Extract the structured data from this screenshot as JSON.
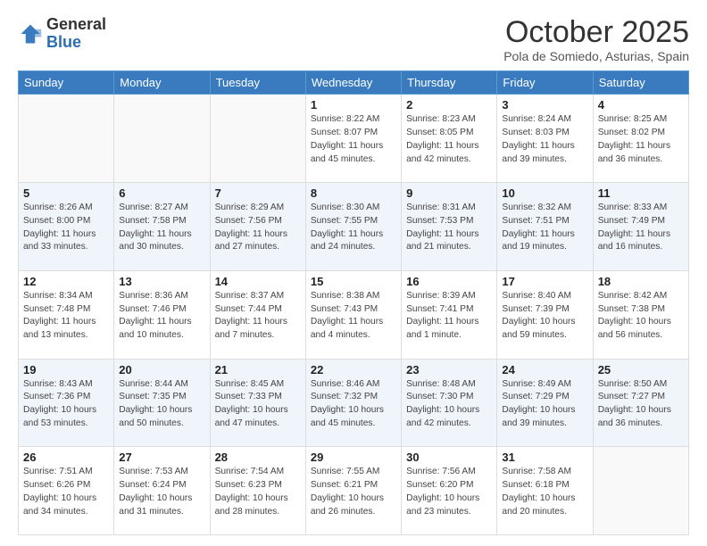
{
  "header": {
    "logo_line1": "General",
    "logo_line2": "Blue",
    "month": "October 2025",
    "location": "Pola de Somiedo, Asturias, Spain"
  },
  "weekdays": [
    "Sunday",
    "Monday",
    "Tuesday",
    "Wednesday",
    "Thursday",
    "Friday",
    "Saturday"
  ],
  "weeks": [
    [
      {
        "day": "",
        "info": ""
      },
      {
        "day": "",
        "info": ""
      },
      {
        "day": "",
        "info": ""
      },
      {
        "day": "1",
        "info": "Sunrise: 8:22 AM\nSunset: 8:07 PM\nDaylight: 11 hours\nand 45 minutes."
      },
      {
        "day": "2",
        "info": "Sunrise: 8:23 AM\nSunset: 8:05 PM\nDaylight: 11 hours\nand 42 minutes."
      },
      {
        "day": "3",
        "info": "Sunrise: 8:24 AM\nSunset: 8:03 PM\nDaylight: 11 hours\nand 39 minutes."
      },
      {
        "day": "4",
        "info": "Sunrise: 8:25 AM\nSunset: 8:02 PM\nDaylight: 11 hours\nand 36 minutes."
      }
    ],
    [
      {
        "day": "5",
        "info": "Sunrise: 8:26 AM\nSunset: 8:00 PM\nDaylight: 11 hours\nand 33 minutes."
      },
      {
        "day": "6",
        "info": "Sunrise: 8:27 AM\nSunset: 7:58 PM\nDaylight: 11 hours\nand 30 minutes."
      },
      {
        "day": "7",
        "info": "Sunrise: 8:29 AM\nSunset: 7:56 PM\nDaylight: 11 hours\nand 27 minutes."
      },
      {
        "day": "8",
        "info": "Sunrise: 8:30 AM\nSunset: 7:55 PM\nDaylight: 11 hours\nand 24 minutes."
      },
      {
        "day": "9",
        "info": "Sunrise: 8:31 AM\nSunset: 7:53 PM\nDaylight: 11 hours\nand 21 minutes."
      },
      {
        "day": "10",
        "info": "Sunrise: 8:32 AM\nSunset: 7:51 PM\nDaylight: 11 hours\nand 19 minutes."
      },
      {
        "day": "11",
        "info": "Sunrise: 8:33 AM\nSunset: 7:49 PM\nDaylight: 11 hours\nand 16 minutes."
      }
    ],
    [
      {
        "day": "12",
        "info": "Sunrise: 8:34 AM\nSunset: 7:48 PM\nDaylight: 11 hours\nand 13 minutes."
      },
      {
        "day": "13",
        "info": "Sunrise: 8:36 AM\nSunset: 7:46 PM\nDaylight: 11 hours\nand 10 minutes."
      },
      {
        "day": "14",
        "info": "Sunrise: 8:37 AM\nSunset: 7:44 PM\nDaylight: 11 hours\nand 7 minutes."
      },
      {
        "day": "15",
        "info": "Sunrise: 8:38 AM\nSunset: 7:43 PM\nDaylight: 11 hours\nand 4 minutes."
      },
      {
        "day": "16",
        "info": "Sunrise: 8:39 AM\nSunset: 7:41 PM\nDaylight: 11 hours\nand 1 minute."
      },
      {
        "day": "17",
        "info": "Sunrise: 8:40 AM\nSunset: 7:39 PM\nDaylight: 10 hours\nand 59 minutes."
      },
      {
        "day": "18",
        "info": "Sunrise: 8:42 AM\nSunset: 7:38 PM\nDaylight: 10 hours\nand 56 minutes."
      }
    ],
    [
      {
        "day": "19",
        "info": "Sunrise: 8:43 AM\nSunset: 7:36 PM\nDaylight: 10 hours\nand 53 minutes."
      },
      {
        "day": "20",
        "info": "Sunrise: 8:44 AM\nSunset: 7:35 PM\nDaylight: 10 hours\nand 50 minutes."
      },
      {
        "day": "21",
        "info": "Sunrise: 8:45 AM\nSunset: 7:33 PM\nDaylight: 10 hours\nand 47 minutes."
      },
      {
        "day": "22",
        "info": "Sunrise: 8:46 AM\nSunset: 7:32 PM\nDaylight: 10 hours\nand 45 minutes."
      },
      {
        "day": "23",
        "info": "Sunrise: 8:48 AM\nSunset: 7:30 PM\nDaylight: 10 hours\nand 42 minutes."
      },
      {
        "day": "24",
        "info": "Sunrise: 8:49 AM\nSunset: 7:29 PM\nDaylight: 10 hours\nand 39 minutes."
      },
      {
        "day": "25",
        "info": "Sunrise: 8:50 AM\nSunset: 7:27 PM\nDaylight: 10 hours\nand 36 minutes."
      }
    ],
    [
      {
        "day": "26",
        "info": "Sunrise: 7:51 AM\nSunset: 6:26 PM\nDaylight: 10 hours\nand 34 minutes."
      },
      {
        "day": "27",
        "info": "Sunrise: 7:53 AM\nSunset: 6:24 PM\nDaylight: 10 hours\nand 31 minutes."
      },
      {
        "day": "28",
        "info": "Sunrise: 7:54 AM\nSunset: 6:23 PM\nDaylight: 10 hours\nand 28 minutes."
      },
      {
        "day": "29",
        "info": "Sunrise: 7:55 AM\nSunset: 6:21 PM\nDaylight: 10 hours\nand 26 minutes."
      },
      {
        "day": "30",
        "info": "Sunrise: 7:56 AM\nSunset: 6:20 PM\nDaylight: 10 hours\nand 23 minutes."
      },
      {
        "day": "31",
        "info": "Sunrise: 7:58 AM\nSunset: 6:18 PM\nDaylight: 10 hours\nand 20 minutes."
      },
      {
        "day": "",
        "info": ""
      }
    ]
  ]
}
